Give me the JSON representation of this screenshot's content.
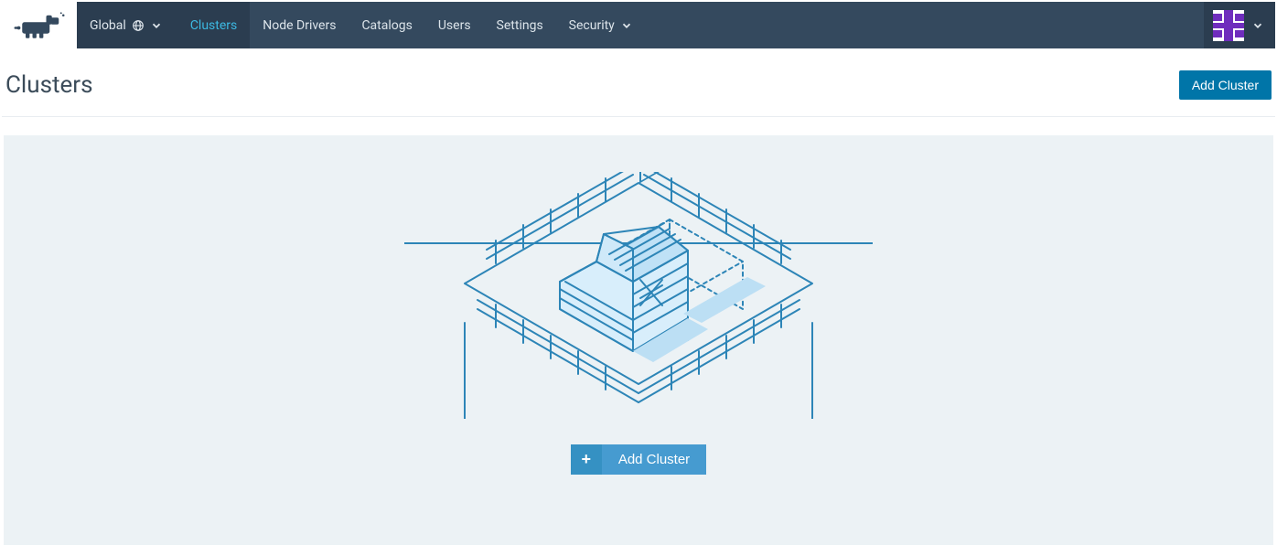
{
  "nav": {
    "scope_label": "Global",
    "tabs": [
      {
        "label": "Clusters"
      },
      {
        "label": "Node Drivers"
      },
      {
        "label": "Catalogs"
      },
      {
        "label": "Users"
      },
      {
        "label": "Settings"
      },
      {
        "label": "Security"
      }
    ]
  },
  "page": {
    "title": "Clusters",
    "add_button": "Add Cluster"
  },
  "empty": {
    "cta_label": "Add Cluster"
  },
  "colors": {
    "navbar": "#34495e",
    "navbar_dark": "#2b3d50",
    "accent": "#3cb9e2",
    "primary_btn": "#0075a8",
    "cta_btn": "#469bd0",
    "panel_bg": "#ecf2f5"
  }
}
